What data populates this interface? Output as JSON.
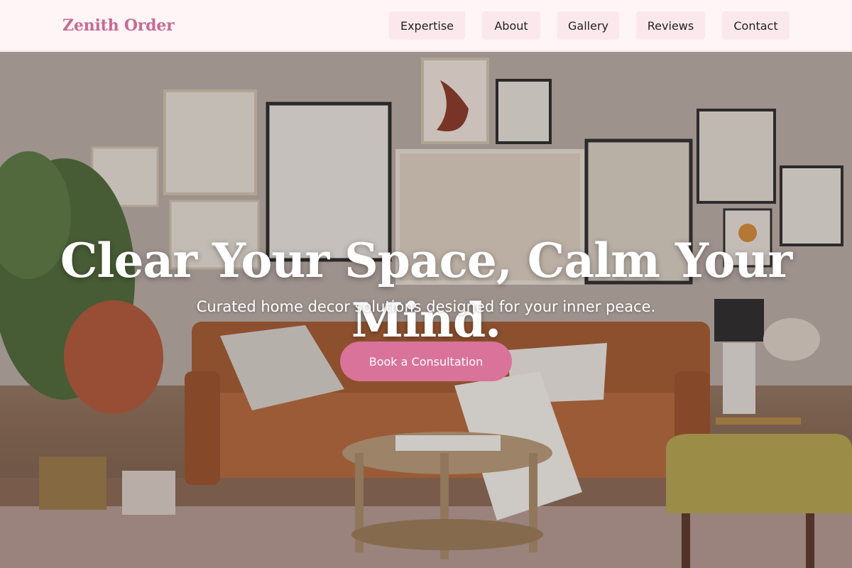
{
  "brand": {
    "name": "Zenith Order"
  },
  "nav": {
    "items": [
      {
        "label": "Expertise"
      },
      {
        "label": "About"
      },
      {
        "label": "Gallery"
      },
      {
        "label": "Reviews"
      },
      {
        "label": "Contact"
      }
    ]
  },
  "hero": {
    "headline": "Clear Your Space, Calm Your Mind.",
    "subheadline": "Curated home decor solutions designed for your inner peace.",
    "cta_label": "Book a Consultation",
    "image": "living-room-gallery-wall-photo"
  },
  "colors": {
    "accent": "#d9739a",
    "logo": "#c96a92",
    "header_bg": "#fff5f6",
    "nav_button_bg": "#fbe8ed"
  }
}
